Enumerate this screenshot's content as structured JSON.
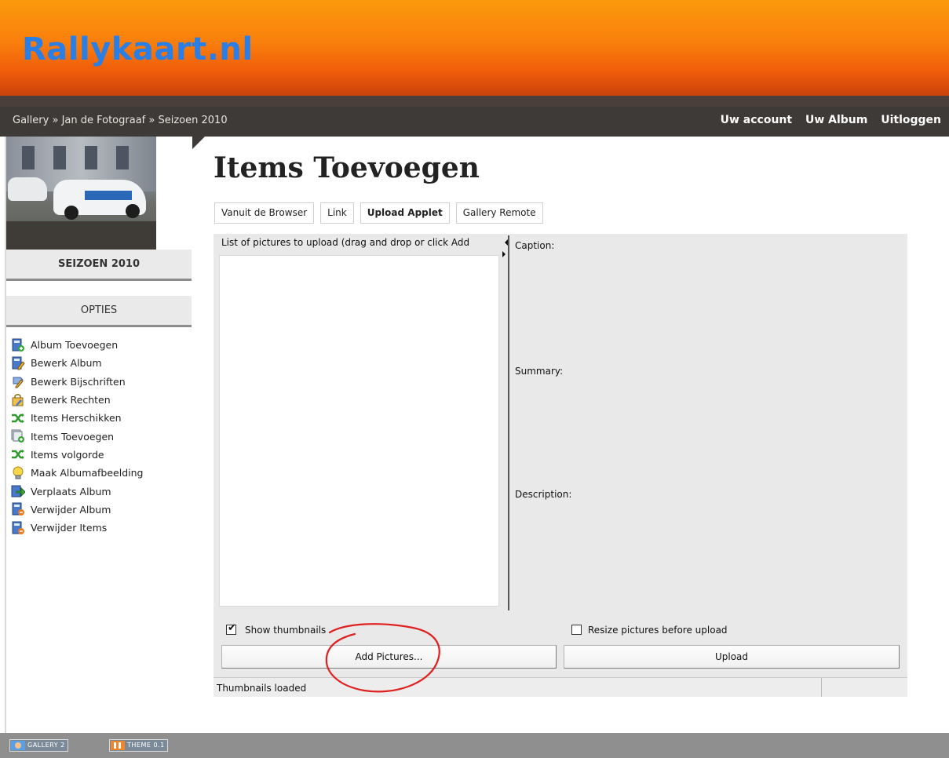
{
  "header": {
    "site_title": "Rallykaart.nl"
  },
  "navbar": {
    "breadcrumb": [
      "Gallery",
      "Jan de Fotograaf",
      "Seizoen 2010"
    ],
    "separator": "»",
    "links": [
      "Uw account",
      "Uw Album",
      "Uitloggen"
    ]
  },
  "sidebar": {
    "album_title": "SEIZOEN 2010",
    "options_heading": "OPTIES",
    "items": [
      {
        "label": "Album Toevoegen",
        "icon": "album-add-icon"
      },
      {
        "label": "Bewerk Album",
        "icon": "album-edit-icon"
      },
      {
        "label": "Bewerk Bijschriften",
        "icon": "captions-edit-icon"
      },
      {
        "label": "Bewerk Rechten",
        "icon": "permissions-edit-icon"
      },
      {
        "label": "Items Herschikken",
        "icon": "shuffle-icon"
      },
      {
        "label": "Items Toevoegen",
        "icon": "items-add-icon"
      },
      {
        "label": "Items volgorde",
        "icon": "shuffle-icon"
      },
      {
        "label": "Maak Albumafbeelding",
        "icon": "lightbulb-icon"
      },
      {
        "label": "Verplaats Album",
        "icon": "move-album-icon"
      },
      {
        "label": "Verwijder Album",
        "icon": "album-delete-icon"
      },
      {
        "label": "Verwijder Items",
        "icon": "items-delete-icon"
      }
    ]
  },
  "main": {
    "title": "Items Toevoegen",
    "tabs": [
      {
        "label": "Vanuit de Browser",
        "active": false
      },
      {
        "label": "Link",
        "active": false
      },
      {
        "label": "Upload Applet",
        "active": true
      },
      {
        "label": "Gallery Remote",
        "active": false
      }
    ]
  },
  "applet": {
    "list_header": "List of pictures to upload (drag and drop or click Add",
    "caption_label": "Caption:",
    "summary_label": "Summary:",
    "description_label": "Description:",
    "show_thumbnails": {
      "label": "Show thumbnails",
      "checked": true
    },
    "resize_pictures": {
      "label": "Resize pictures before upload",
      "checked": false
    },
    "add_button": "Add Pictures...",
    "upload_button": "Upload",
    "status": "Thumbnails loaded",
    "annotation_color": "#e02020"
  },
  "footer": {
    "badges": [
      {
        "label": "GALLERY 2",
        "color": "#f0862a"
      },
      {
        "label": "THEME 0.1",
        "color": "#f0862a"
      }
    ]
  },
  "colors": {
    "accent": "#2a7fe6",
    "header_orange": "#f97e0c",
    "navbar": "#3e3a38"
  }
}
